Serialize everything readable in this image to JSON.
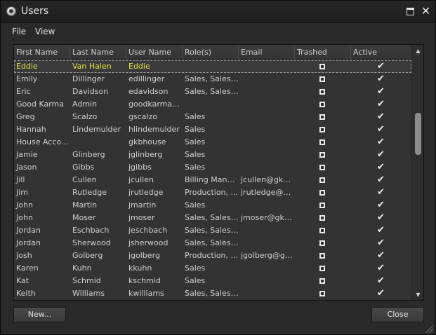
{
  "window": {
    "title": "Users"
  },
  "menu": {
    "items": [
      "File",
      "View"
    ]
  },
  "grid": {
    "columns": [
      "First Name",
      "Last Name",
      "User Name",
      "Role(s)",
      "Email",
      "Trashed",
      "Active"
    ],
    "rows": [
      {
        "first": "Eddie",
        "last": "Van Halen",
        "user": "Eddie",
        "roles": "",
        "email": "",
        "trashed": false,
        "active": true,
        "selected": true
      },
      {
        "first": "Emily",
        "last": "Dillinger",
        "user": "edillinger",
        "roles": "Sales, Sales ...",
        "email": "",
        "trashed": false,
        "active": true
      },
      {
        "first": "Eric",
        "last": "Davidson",
        "user": "edavidson",
        "roles": "Sales, Sales ...",
        "email": "",
        "trashed": false,
        "active": true
      },
      {
        "first": "Good Karma",
        "last": "Admin",
        "user": "goodkarmaa...",
        "roles": "",
        "email": "",
        "trashed": false,
        "active": true
      },
      {
        "first": "Greg",
        "last": "Scalzo",
        "user": "gscalzo",
        "roles": "Sales",
        "email": "",
        "trashed": false,
        "active": true
      },
      {
        "first": "Hannah",
        "last": "Lindemulder",
        "user": "hlindemulder",
        "roles": "Sales",
        "email": "",
        "trashed": false,
        "active": true
      },
      {
        "first": "House Account",
        "last": "",
        "user": "gkbhouse",
        "roles": "Sales",
        "email": "",
        "trashed": false,
        "active": true
      },
      {
        "first": "Jamie",
        "last": "Glinberg",
        "user": "jglinberg",
        "roles": "Sales",
        "email": "",
        "trashed": false,
        "active": true
      },
      {
        "first": "Jason",
        "last": "Gibbs",
        "user": "jgibbs",
        "roles": "Sales",
        "email": "",
        "trashed": false,
        "active": true
      },
      {
        "first": "Jill",
        "last": "Cullen",
        "user": "jcullen",
        "roles": "Billing Manag...",
        "email": "jcullen@gkbs....",
        "trashed": false,
        "active": true
      },
      {
        "first": "Jim",
        "last": "Rutledge",
        "user": "jrutledge",
        "roles": "Production, ...",
        "email": "jrutledge@g....",
        "trashed": false,
        "active": true
      },
      {
        "first": "John",
        "last": "Martin",
        "user": "jmartin",
        "roles": "Sales",
        "email": "",
        "trashed": false,
        "active": true
      },
      {
        "first": "John",
        "last": "Moser",
        "user": "jmoser",
        "roles": "Sales, Sales ...",
        "email": "jmoser@gkb....",
        "trashed": false,
        "active": true
      },
      {
        "first": "Jordan",
        "last": "Eschbach",
        "user": "jeschbach",
        "roles": "Sales, Sales ...",
        "email": "",
        "trashed": false,
        "active": true
      },
      {
        "first": "Jordan",
        "last": "Sherwood",
        "user": "jsherwood",
        "roles": "Sales, Sales ...",
        "email": "",
        "trashed": false,
        "active": true
      },
      {
        "first": "Josh",
        "last": "Golberg",
        "user": "jgolberg",
        "roles": "Production, ...",
        "email": "jgolberg@gk....",
        "trashed": false,
        "active": true
      },
      {
        "first": "Karen",
        "last": "Kuhn",
        "user": "kkuhn",
        "roles": "Sales",
        "email": "",
        "trashed": false,
        "active": true
      },
      {
        "first": "Kat",
        "last": "Schmid",
        "user": "kschmid",
        "roles": "Sales",
        "email": "",
        "trashed": false,
        "active": true
      },
      {
        "first": "Keith",
        "last": "Williams",
        "user": "kwilliams",
        "roles": "Sales, Sales ...",
        "email": "",
        "trashed": false,
        "active": true
      }
    ]
  },
  "buttons": {
    "new_label": "New...",
    "close_label": "Close"
  },
  "icons": {
    "app": "users-app-icon",
    "maximize": "maximize-icon",
    "close": "close-icon",
    "checkbox": "checkbox-icon",
    "checkmark": "checkmark-icon"
  },
  "colors": {
    "selected_text": "#e3e34a",
    "background": "#2a2a2a"
  }
}
